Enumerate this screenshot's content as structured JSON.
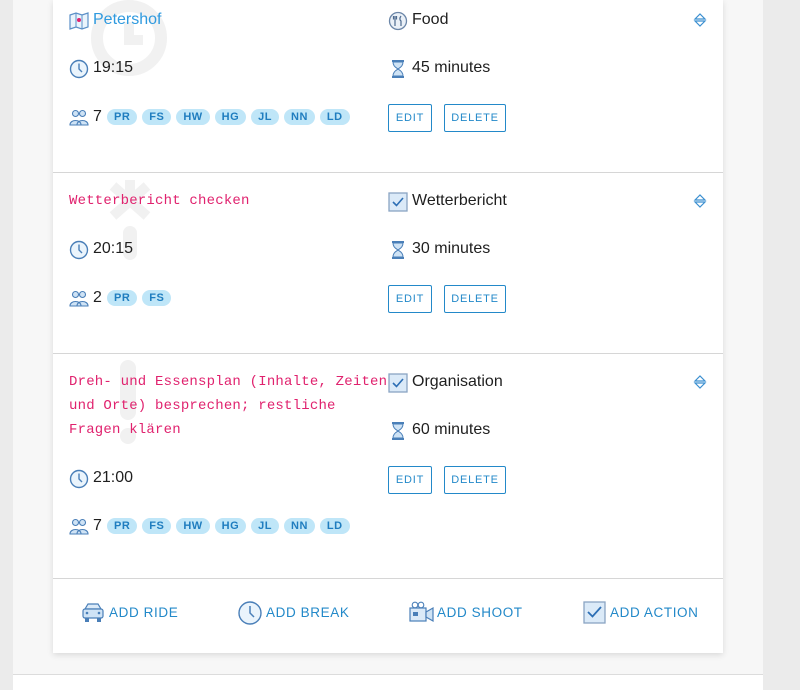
{
  "entries": [
    {
      "title": "Petershof",
      "category": "Food",
      "time": "19:15",
      "duration": "45 minutes",
      "people_count": "7",
      "people": [
        "PR",
        "FS",
        "HW",
        "HG",
        "JL",
        "NN",
        "LD"
      ],
      "edit_label": "EDIT",
      "delete_label": "DELETE"
    },
    {
      "title": "Wetterbericht checken",
      "category": "Wetterbericht",
      "time": "20:15",
      "duration": "30 minutes",
      "people_count": "2",
      "people": [
        "PR",
        "FS"
      ],
      "edit_label": "EDIT",
      "delete_label": "DELETE"
    },
    {
      "title_lines": [
        "Dreh- und Essensplan (Inhalte, Zeiten",
        "und Orte) besprechen; restliche",
        "Fragen klären"
      ],
      "category": "Organisation",
      "time": "21:00",
      "duration": "60 minutes",
      "people_count": "7",
      "people": [
        "PR",
        "FS",
        "HW",
        "HG",
        "JL",
        "NN",
        "LD"
      ],
      "edit_label": "EDIT",
      "delete_label": "DELETE"
    }
  ],
  "footer_actions": {
    "add_ride": "ADD RIDE",
    "add_break": "ADD BREAK",
    "add_shoot": "ADD SHOOT",
    "add_action": "ADD ACTION"
  },
  "icons": {
    "map": "map-icon",
    "food": "food-icon",
    "clock": "clock-icon",
    "hourglass": "hourglass-icon",
    "people": "people-icon",
    "checkbox": "checkbox-icon",
    "sort": "sort-icon",
    "car": "car-icon",
    "camera": "camera-icon"
  },
  "colors": {
    "accent": "#2389c9",
    "title_link": "#2f9adf",
    "mono_title": "#e0226e",
    "badge_bg": "#bfe6f8",
    "badge_text": "#1f7dbf"
  }
}
